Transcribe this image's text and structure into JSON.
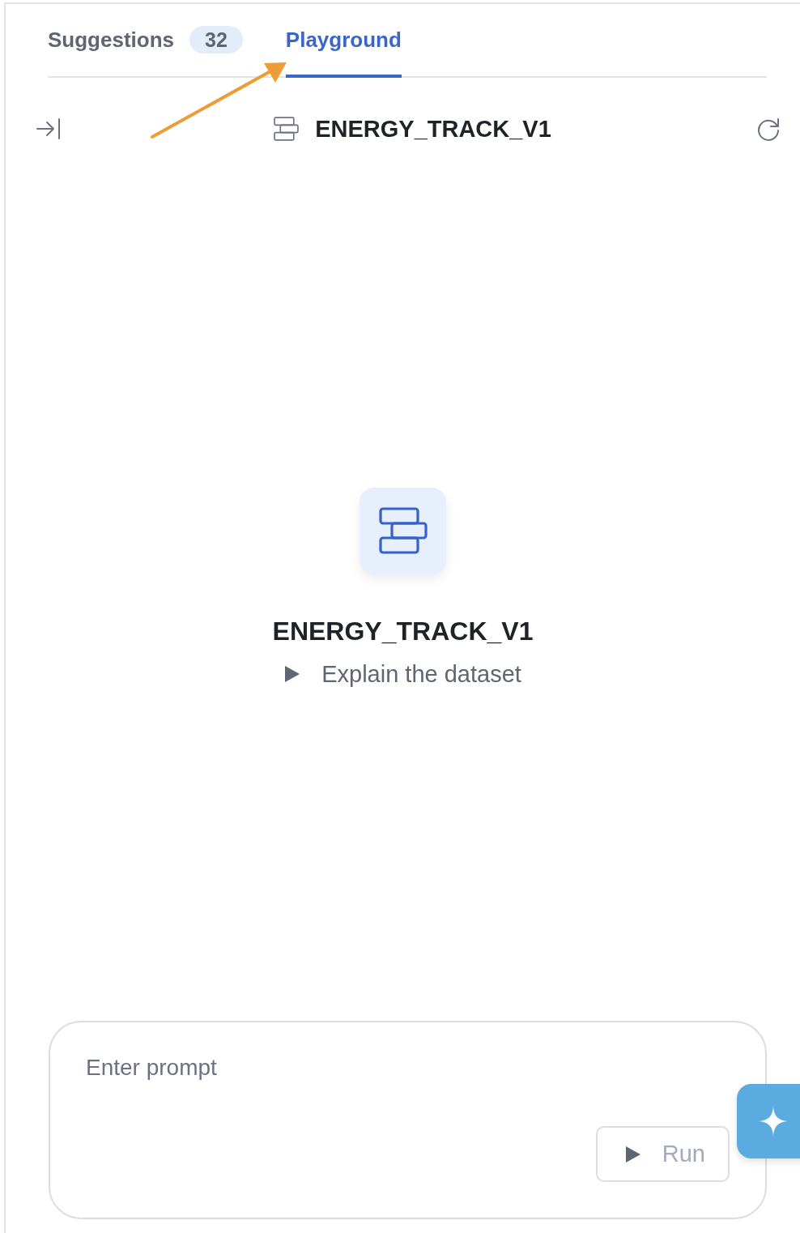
{
  "tabs": [
    {
      "label": "Suggestions",
      "badge": "32",
      "selected": false
    },
    {
      "label": "Playground",
      "selected": true
    }
  ],
  "header": {
    "title": "ENERGY_TRACK_V1"
  },
  "empty_state": {
    "title": "ENERGY_TRACK_V1",
    "suggestions": [
      {
        "label": "Explain the dataset"
      }
    ]
  },
  "prompt": {
    "placeholder": "Enter prompt",
    "run_button": {
      "label": "Run",
      "disabled": true
    }
  }
}
